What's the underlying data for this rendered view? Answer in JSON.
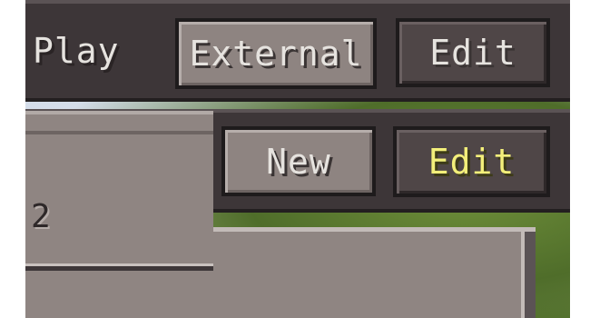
{
  "top_bar": {
    "play_label": "Play",
    "external_button": "External",
    "edit_button": "Edit"
  },
  "second_bar": {
    "new_button": "New",
    "edit_button": "Edit",
    "edit_state": "hover",
    "hover_text_color": "#f3ef7a"
  },
  "list_frame": {
    "partial_text": "2"
  },
  "colors": {
    "panel_dark": "#3d3638",
    "button_light": "#8e8481",
    "button_dark": "#4f4647",
    "text": "#e6e3df"
  }
}
